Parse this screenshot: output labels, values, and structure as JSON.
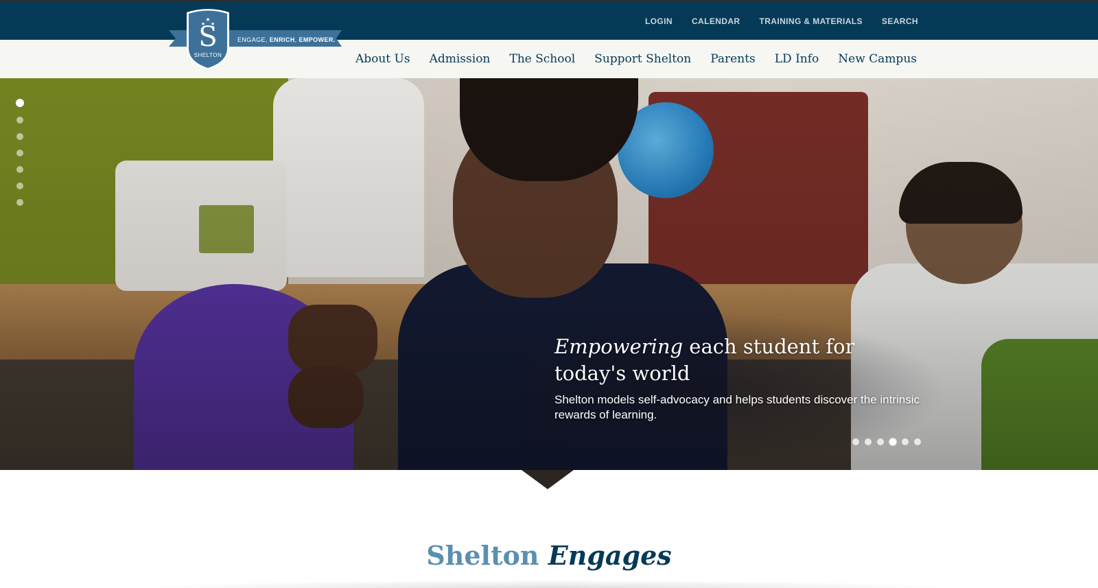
{
  "brand": {
    "shield_letter": "S",
    "shield_name": "SHELTON",
    "tagline_parts": [
      "ENGAGE, ",
      "ENRICH",
      ", ",
      "EMPOWER."
    ],
    "colors": {
      "navy": "#053a57",
      "light_blue": "#5b8fb0",
      "shield": "#3d7199"
    }
  },
  "utility_nav": {
    "items": [
      {
        "label": "LOGIN"
      },
      {
        "label": "CALENDAR"
      },
      {
        "label": "TRAINING & MATERIALS"
      },
      {
        "label": "SEARCH"
      }
    ]
  },
  "main_nav": {
    "items": [
      {
        "label": "About Us"
      },
      {
        "label": "Admission"
      },
      {
        "label": "The School"
      },
      {
        "label": "Support Shelton"
      },
      {
        "label": "Parents"
      },
      {
        "label": "LD Info"
      },
      {
        "label": "New Campus"
      }
    ]
  },
  "hero": {
    "headline_em": "Empowering",
    "headline_rest": " each student for today's world",
    "subtext": "Shelton models self-advocacy and helps students discover the intrinsic rewards of learning.",
    "vertical_dots": {
      "count": 7,
      "active_index": 0
    },
    "horizontal_dots": {
      "count": 6,
      "active_index": 3
    }
  },
  "section": {
    "title_part1": "Shelton ",
    "title_part2": "Engages"
  }
}
